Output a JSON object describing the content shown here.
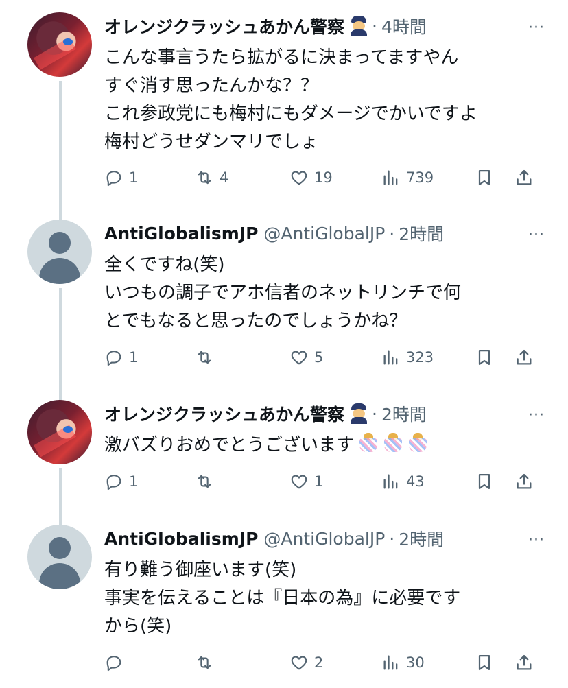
{
  "thread": [
    {
      "author": "オレンジクラッシュあかん警察",
      "has_police_emoji": true,
      "handle": "",
      "time": "4時間",
      "lines": [
        "こんな事言うたら拡がるに決まってますやん",
        "すぐ消す思ったんかな？？",
        "これ参政党にも梅村にもダメージでかいですよ",
        "梅村どうせダンマリでしょ"
      ],
      "reply_count": "1",
      "retweet_count": "4",
      "like_count": "19",
      "view_count": "739"
    },
    {
      "author": "AntiGlobalismJP",
      "has_police_emoji": false,
      "handle": "@AntiGlobalJP",
      "time": "2時間",
      "lines": [
        "全くですね(笑)",
        "いつもの調子でアホ信者のネットリンチで何",
        "とでもなると思ったのでしょうかね？"
      ],
      "reply_count": "1",
      "retweet_count": "",
      "like_count": "5",
      "view_count": "323"
    },
    {
      "author": "オレンジクラッシュあかん警察",
      "has_police_emoji": true,
      "handle": "",
      "time": "2時間",
      "lines": [
        "激バズりおめでとうございます"
      ],
      "confetti_emoji_count": 3,
      "reply_count": "1",
      "retweet_count": "",
      "like_count": "1",
      "view_count": "43"
    },
    {
      "author": "AntiGlobalismJP",
      "has_police_emoji": false,
      "handle": "@AntiGlobalJP",
      "time": "2時間",
      "lines": [
        "有り難う御座います(笑)",
        "事実を伝えることは『日本の為』に必要です",
        "から(笑)"
      ],
      "reply_count": "",
      "retweet_count": "",
      "like_count": "2",
      "view_count": "30"
    }
  ],
  "separator": "·",
  "more_label": "···",
  "icons": {
    "reply": "reply-icon",
    "retweet": "retweet-icon",
    "like": "heart-icon",
    "views": "views-chart-icon",
    "bookmark": "bookmark-icon",
    "share": "share-icon",
    "more": "more-icon",
    "police": "police-officer-emoji",
    "confetti": "confetti-ball-emoji"
  },
  "colors": {
    "text": "#0f1419",
    "secondary": "#536471",
    "thread_line": "#cfd9de"
  }
}
